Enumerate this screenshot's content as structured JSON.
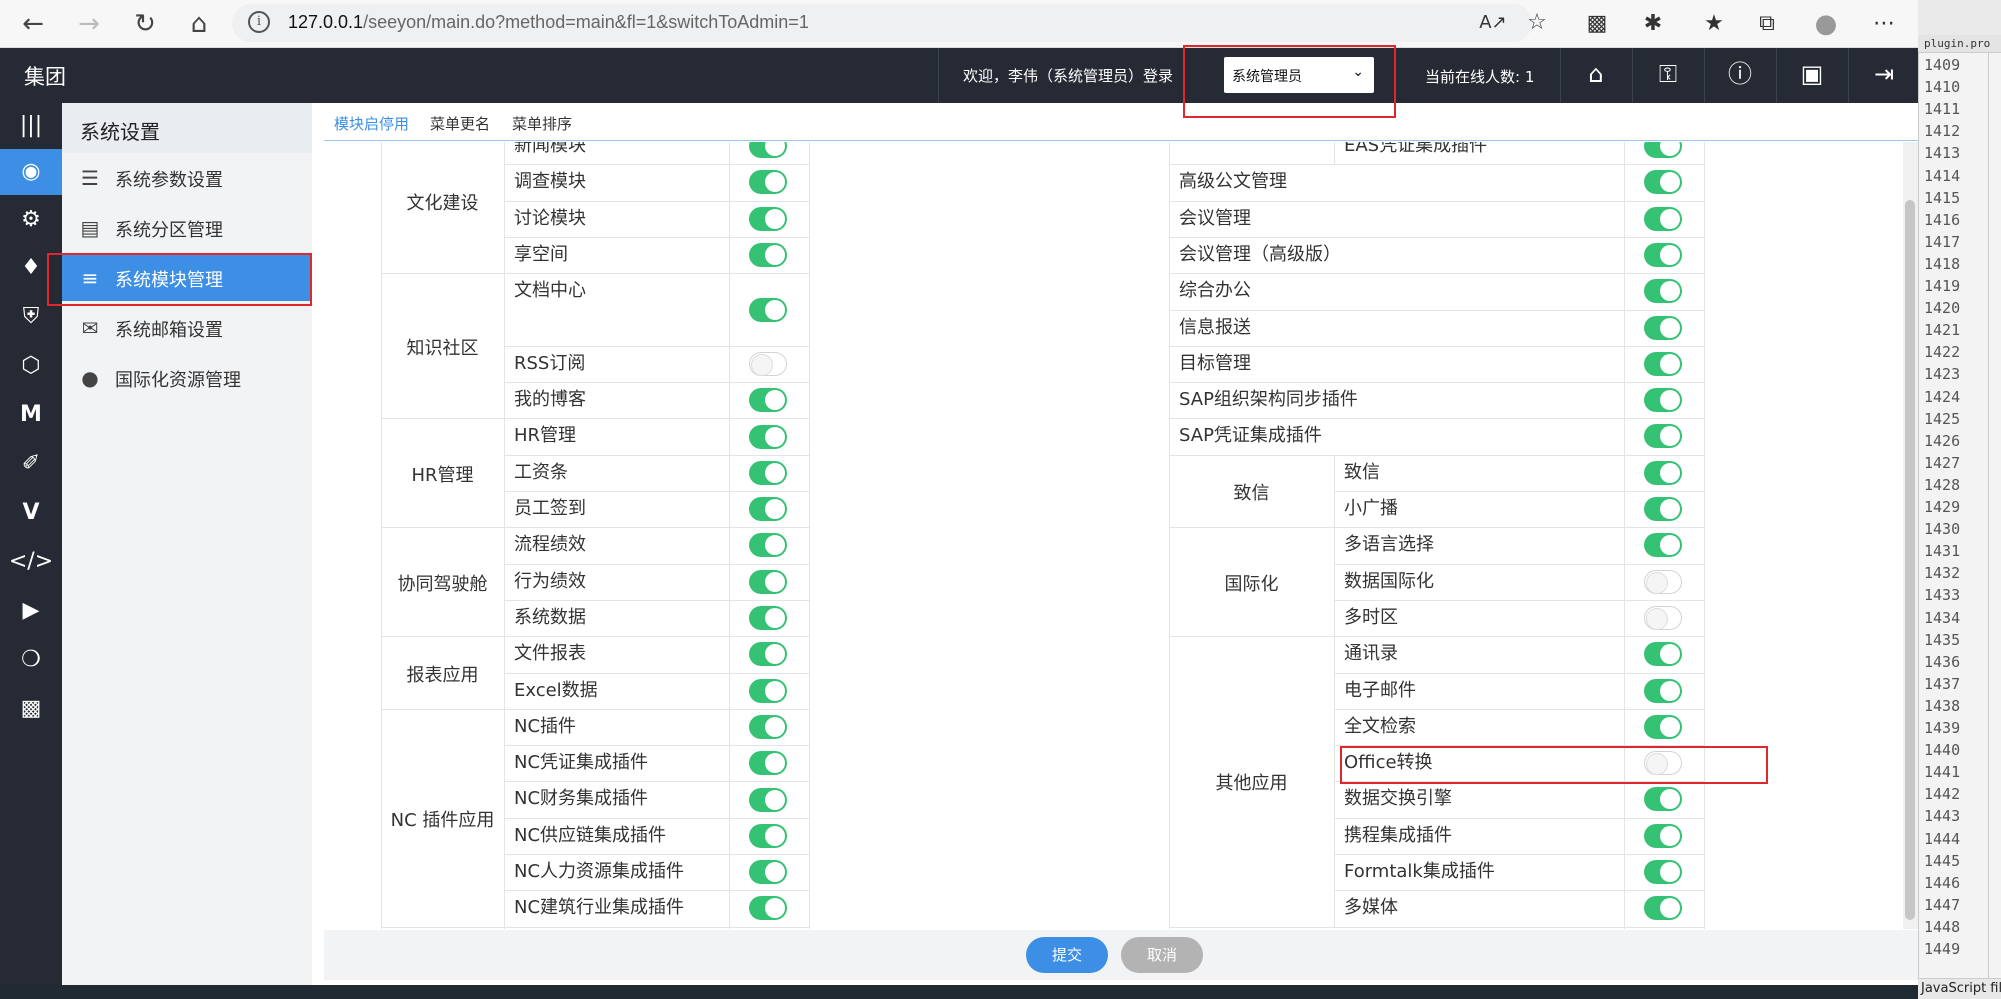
{
  "browser": {
    "url_host": "127.0.0.1",
    "url_path": "/seeyon/main.do?method=main&fl=1&switchToAdmin=1"
  },
  "header": {
    "brand": "集团",
    "welcome": "欢迎，李伟（系统管理员）登录",
    "role_selected": "系统管理员",
    "online_count": "当前在线人数: 1"
  },
  "sidebar": {
    "title": "系统设置",
    "items": [
      {
        "label": "系统参数设置",
        "icon": "sliders-icon"
      },
      {
        "label": "系统分区管理",
        "icon": "drive-icon"
      },
      {
        "label": "系统模块管理",
        "icon": "list-icon",
        "active": true
      },
      {
        "label": "系统邮箱设置",
        "icon": "mail-icon"
      },
      {
        "label": "国际化资源管理",
        "icon": "globe-icon"
      }
    ]
  },
  "tabs": [
    {
      "label": "模块启停用",
      "active": true
    },
    {
      "label": "菜单更名"
    },
    {
      "label": "菜单排序"
    }
  ],
  "left_table": {
    "groups": [
      {
        "name": "文化建设",
        "modules": [
          {
            "name": "新闻模块",
            "enabled": true
          },
          {
            "name": "调查模块",
            "enabled": true
          },
          {
            "name": "讨论模块",
            "enabled": true
          },
          {
            "name": "享空间",
            "enabled": true
          }
        ]
      },
      {
        "name": "知识社区",
        "modules": [
          {
            "name": "文档中心",
            "enabled": true
          },
          {
            "name": "RSS订阅",
            "enabled": false
          },
          {
            "name": "我的博客",
            "enabled": true
          }
        ]
      },
      {
        "name": "HR管理",
        "modules": [
          {
            "name": "HR管理",
            "enabled": true
          },
          {
            "name": "工资条",
            "enabled": true
          },
          {
            "name": "员工签到",
            "enabled": true
          }
        ]
      },
      {
        "name": "协同驾驶舱",
        "modules": [
          {
            "name": "流程绩效",
            "enabled": true
          },
          {
            "name": "行为绩效",
            "enabled": true
          },
          {
            "name": "系统数据",
            "enabled": true
          }
        ]
      },
      {
        "name": "报表应用",
        "modules": [
          {
            "name": "文件报表",
            "enabled": true
          },
          {
            "name": "Excel数据",
            "enabled": true
          }
        ]
      },
      {
        "name": "NC 插件应用",
        "modules": [
          {
            "name": "NC插件",
            "enabled": true
          },
          {
            "name": "NC凭证集成插件",
            "enabled": true
          },
          {
            "name": "NC财务集成插件",
            "enabled": true
          },
          {
            "name": "NC供应链集成插件",
            "enabled": true
          },
          {
            "name": "NC人力资源集成插件",
            "enabled": true
          },
          {
            "name": "NC建筑行业集成插件",
            "enabled": true
          }
        ]
      }
    ]
  },
  "right_table": {
    "partial_top": {
      "name": "EAS凭证集成插件",
      "enabled": true
    },
    "singles": [
      {
        "name": "高级公文管理",
        "enabled": true
      },
      {
        "name": "会议管理",
        "enabled": true
      },
      {
        "name": "会议管理（高级版）",
        "enabled": true
      },
      {
        "name": "综合办公",
        "enabled": true
      },
      {
        "name": "信息报送",
        "enabled": true
      },
      {
        "name": "目标管理",
        "enabled": true
      },
      {
        "name": "SAP组织架构同步插件",
        "enabled": true
      },
      {
        "name": "SAP凭证集成插件",
        "enabled": true
      }
    ],
    "groups": [
      {
        "name": "致信",
        "modules": [
          {
            "name": "致信",
            "enabled": true
          },
          {
            "name": "小广播",
            "enabled": true
          }
        ]
      },
      {
        "name": "国际化",
        "modules": [
          {
            "name": "多语言选择",
            "enabled": true
          },
          {
            "name": "数据国际化",
            "enabled": false
          },
          {
            "name": "多时区",
            "enabled": false
          }
        ]
      },
      {
        "name": "其他应用",
        "modules": [
          {
            "name": "通讯录",
            "enabled": true
          },
          {
            "name": "电子邮件",
            "enabled": true
          },
          {
            "name": "全文检索",
            "enabled": true
          },
          {
            "name": "Office转换",
            "enabled": false
          },
          {
            "name": "数据交换引擎",
            "enabled": true
          },
          {
            "name": "携程集成插件",
            "enabled": true
          },
          {
            "name": "Formtalk集成插件",
            "enabled": true
          },
          {
            "name": "多媒体",
            "enabled": true
          }
        ]
      }
    ]
  },
  "footer": {
    "submit_label": "提交",
    "cancel_label": "取消"
  },
  "editor": {
    "tab_label": "plugin.pro",
    "line_numbers": [
      "1409",
      "1410",
      "1411",
      "1412",
      "1413",
      "1414",
      "1415",
      "1416",
      "1417",
      "1418",
      "1419",
      "1420",
      "1421",
      "1422",
      "1423",
      "1424",
      "1425",
      "1426",
      "1427",
      "1428",
      "1429",
      "1430",
      "1431",
      "1432",
      "1433",
      "1434",
      "1435",
      "1436",
      "1437",
      "1438",
      "1439",
      "1440",
      "1441",
      "1442",
      "1443",
      "1444",
      "1445",
      "1446",
      "1447",
      "1448",
      "1449"
    ],
    "status": "JavaScript file"
  },
  "colors": {
    "accent": "#3d8fe6",
    "toggle_on": "#36c275",
    "header_bg": "#252a34",
    "highlight_border": "#e0272b"
  }
}
